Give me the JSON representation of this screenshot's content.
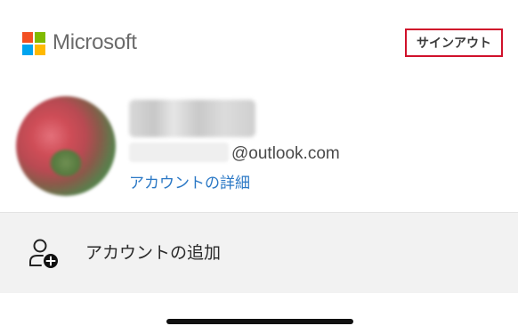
{
  "header": {
    "brand_name": "Microsoft",
    "logo_colors": [
      "#f25022",
      "#7fba00",
      "#00a4ef",
      "#ffb900"
    ],
    "signout_label": "サインアウト",
    "signout_border_color": "#d0112b"
  },
  "account": {
    "email_domain": "@outlook.com",
    "details_link": "アカウントの詳細",
    "link_color": "#2b78c5"
  },
  "add_account": {
    "label": "アカウントの追加",
    "icon": "add-person-icon"
  }
}
